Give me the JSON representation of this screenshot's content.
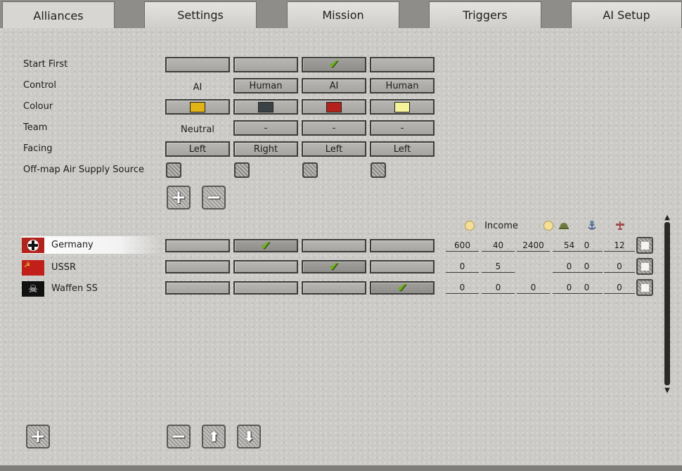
{
  "tabs": [
    {
      "label": "Alliances",
      "active": true
    },
    {
      "label": "Settings",
      "active": false
    },
    {
      "label": "Mission",
      "active": false
    },
    {
      "label": "Triggers",
      "active": false
    },
    {
      "label": "AI Setup",
      "active": false
    }
  ],
  "settings": {
    "labels": {
      "start_first": "Start First",
      "control": "Control",
      "colour": "Colour",
      "team": "Team",
      "facing": "Facing",
      "air_supply": "Off-map Air Supply Source"
    },
    "start_first_checked_index": 2,
    "control": [
      "AI",
      "Human",
      "AI",
      "Human"
    ],
    "colours": [
      "#e1b414",
      "#3a4246",
      "#b5221c",
      "#f6f49a"
    ],
    "team": [
      "Neutral",
      "-",
      "-",
      "-"
    ],
    "facing": [
      "Left",
      "Right",
      "Left",
      "Left"
    ]
  },
  "add_alliance_label": "+",
  "remove_alliance_label": "−",
  "resource_header": {
    "income_label": "Income",
    "icons": [
      "coin-icon",
      "coin-icon",
      "helmet-icon",
      "anchor-icon",
      "plane-icon"
    ]
  },
  "factions": [
    {
      "name": "Germany",
      "flag_icon": "iron-cross-flag-icon",
      "alliance_index": 1,
      "values": [
        "600",
        "40",
        "2400",
        "54",
        "0",
        "12"
      ],
      "selected": true
    },
    {
      "name": "USSR",
      "flag_icon": "hammer-sickle-flag-icon",
      "alliance_index": 2,
      "values": [
        "0",
        "5",
        "",
        "0",
        "0",
        "0"
      ],
      "selected": false
    },
    {
      "name": "Waffen SS",
      "flag_icon": "totenkopf-flag-icon",
      "alliance_index": 3,
      "values": [
        "0",
        "0",
        "0",
        "0",
        "0",
        "0"
      ],
      "selected": false
    }
  ],
  "bottom_buttons": {
    "add": "+",
    "remove": "−",
    "up": "⬆",
    "down": "⬇"
  },
  "checkmark": "✔"
}
